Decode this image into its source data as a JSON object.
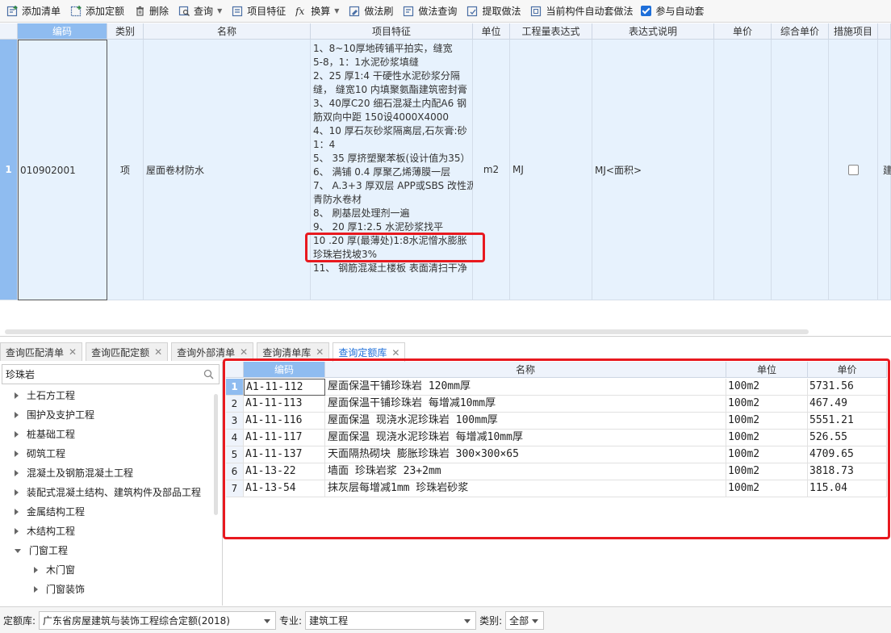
{
  "toolbar": {
    "items": [
      {
        "label": "添加清单",
        "icon": "add-list-icon"
      },
      {
        "label": "添加定额",
        "icon": "add-quota-icon"
      },
      {
        "label": "删除",
        "icon": "trash-icon"
      },
      {
        "label": "查询",
        "icon": "query-icon"
      },
      {
        "label": "项目特征",
        "icon": "feature-icon"
      },
      {
        "label": "换算",
        "icon": "fx-icon"
      },
      {
        "label": "做法刷",
        "icon": "brush-icon"
      },
      {
        "label": "做法查询",
        "icon": "method-query-icon"
      },
      {
        "label": "提取做法",
        "icon": "extract-icon"
      },
      {
        "label": "当前构件自动套做法",
        "icon": "auto-apply-icon"
      }
    ],
    "auto_check_label": "参与自动套"
  },
  "top_grid": {
    "headers": {
      "code": "编码",
      "type": "类别",
      "name": "名称",
      "feature": "项目特征",
      "unit": "单位",
      "expr": "工程量表达式",
      "expr_desc": "表达式说明",
      "price": "单价",
      "total_price": "综合单价",
      "measure": "措施项目"
    },
    "row": {
      "num": "1",
      "code": "010902001",
      "type": "项",
      "name": "屋面卷材防水",
      "unit": "m2",
      "expr": "MJ",
      "expr_desc": "MJ<面积>",
      "extra": "建",
      "feature_lines": [
        "1、8~10厚地砖铺平拍实，缝宽",
        "5-8，1：1水泥砂浆填缝",
        "2、25 厚1:4 干硬性水泥砂浆分隔",
        "缝， 缝宽10 内填聚氨酯建筑密封膏",
        "3、40厚C20 细石混凝土内配A6 钢",
        "筋双向中距 150设4000X4000",
        "4、10 厚石灰砂浆隔离层,石灰膏:砂",
        "1：4",
        "5、 35 厚挤塑聚苯板(设计值为35）",
        "6、 满铺 0.4 厚聚乙烯薄膜一层",
        "7、 A.3+3 厚双层 APP或SBS 改性沥",
        "青防水卷材",
        "8、 刷基层处理剂一遍",
        "9、 20 厚1:2.5 水泥砂浆找平",
        "10 .20 厚(最薄处)1:8水泥憎水膨胀",
        "珍珠岩找坡3%",
        "11、 钢筋混凝土楼板 表面清扫干净"
      ]
    }
  },
  "tabs": [
    {
      "label": "查询匹配清单"
    },
    {
      "label": "查询匹配定额"
    },
    {
      "label": "查询外部清单"
    },
    {
      "label": "查询清单库"
    },
    {
      "label": "查询定额库"
    }
  ],
  "search": {
    "value": "珍珠岩"
  },
  "tree": [
    {
      "label": "土石方工程",
      "expanded": false,
      "level": 0
    },
    {
      "label": "围护及支护工程",
      "expanded": false,
      "level": 0
    },
    {
      "label": "桩基础工程",
      "expanded": false,
      "level": 0
    },
    {
      "label": "砌筑工程",
      "expanded": false,
      "level": 0
    },
    {
      "label": "混凝土及钢筋混凝土工程",
      "expanded": false,
      "level": 0
    },
    {
      "label": "装配式混凝土结构、建筑构件及部品工程",
      "expanded": false,
      "level": 0
    },
    {
      "label": "金属结构工程",
      "expanded": false,
      "level": 0
    },
    {
      "label": "木结构工程",
      "expanded": false,
      "level": 0
    },
    {
      "label": "门窗工程",
      "expanded": true,
      "level": 0
    },
    {
      "label": "木门窗",
      "expanded": false,
      "level": 1
    },
    {
      "label": "门窗装饰",
      "expanded": false,
      "level": 1
    }
  ],
  "results": {
    "headers": {
      "code": "编码",
      "name": "名称",
      "unit": "单位",
      "price": "单价"
    },
    "rows": [
      {
        "num": "1",
        "code": "A1-11-112",
        "name": "屋面保温干铺珍珠岩 120mm厚",
        "unit": "100m2",
        "price": "5731.56"
      },
      {
        "num": "2",
        "code": "A1-11-113",
        "name": "屋面保温干铺珍珠岩 每增减10mm厚",
        "unit": "100m2",
        "price": "467.49"
      },
      {
        "num": "3",
        "code": "A1-11-116",
        "name": "屋面保温 现浇水泥珍珠岩 100mm厚",
        "unit": "100m2",
        "price": "5551.21"
      },
      {
        "num": "4",
        "code": "A1-11-117",
        "name": "屋面保温 现浇水泥珍珠岩 每增减10mm厚",
        "unit": "100m2",
        "price": "526.55"
      },
      {
        "num": "5",
        "code": "A1-11-137",
        "name": "天面隔热砌块 膨胀珍珠岩 300×300×65",
        "unit": "100m2",
        "price": "4709.65"
      },
      {
        "num": "6",
        "code": "A1-13-22",
        "name": "墙面 珍珠岩浆 23+2mm",
        "unit": "100m2",
        "price": "3818.73"
      },
      {
        "num": "7",
        "code": "A1-13-54",
        "name": "抹灰层每增减1mm 珍珠岩砂浆",
        "unit": "100m2",
        "price": "115.04"
      }
    ]
  },
  "bottom": {
    "quota_lib_label": "定额库:",
    "quota_lib_value": "广东省房屋建筑与装饰工程综合定额(2018)",
    "specialty_label": "专业:",
    "specialty_value": "建筑工程",
    "category_label": "类别:",
    "category_value": "全部"
  },
  "colors": {
    "accent": "#1e6fd9",
    "highlight": "#e8191f",
    "row_selected": "#e7f2fd",
    "header_selected": "#8fbcf0"
  }
}
